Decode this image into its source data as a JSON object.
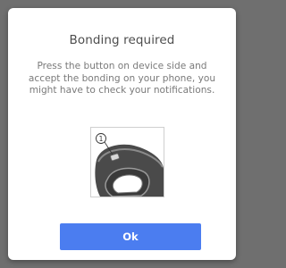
{
  "dialog": {
    "title": "Bonding required",
    "message": "Press the button on device side and accept the bonding on your phone, you might have to check your notifications.",
    "illustration": {
      "callout_number": "1",
      "description_icon": "device-side-button-illustration"
    },
    "ok_label": "Ok"
  },
  "colors": {
    "backdrop": "#6f6f6f",
    "dialog_background": "#ffffff",
    "title_text": "#4d4d4d",
    "message_text": "#7a7a7a",
    "button_background": "#4b7df0",
    "button_text": "#ffffff"
  }
}
